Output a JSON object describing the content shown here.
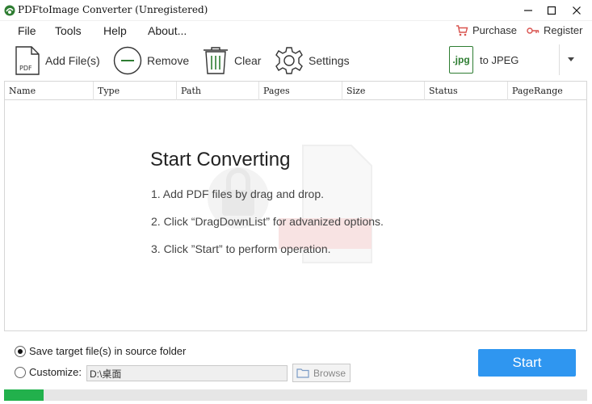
{
  "window": {
    "title": "PDFtoImage Converter (Unregistered)"
  },
  "menu": {
    "items": [
      "File",
      "Tools",
      "Help",
      "About..."
    ],
    "purchase_label": "Purchase",
    "register_label": "Register"
  },
  "toolbar": {
    "add_files_label": "Add File(s)",
    "remove_label": "Remove",
    "clear_label": "Clear",
    "settings_label": "Settings",
    "format_icon_text": ".jpg",
    "format_label": "to JPEG"
  },
  "grid": {
    "columns": [
      "Name",
      "Type",
      "Path",
      "Pages",
      "Size",
      "Status",
      "PageRange"
    ]
  },
  "empty_state": {
    "title": "Start Converting",
    "steps": [
      "1. Add PDF files by drag and drop.",
      "2. Click “DragDownList” for advanized options.",
      "3. Click ”Start” to perform operation."
    ]
  },
  "output": {
    "source_folder_label": "Save target file(s) in source folder",
    "customize_label": "Customize:",
    "path_value": "D:\\桌面",
    "browse_label": "Browse",
    "selected_option": "source_folder"
  },
  "start_label": "Start",
  "progress": {
    "fraction": 0.068
  },
  "colors": {
    "accent": "#2f96f0",
    "progress": "#22b14c",
    "purchase_icon": "#d9534f"
  }
}
